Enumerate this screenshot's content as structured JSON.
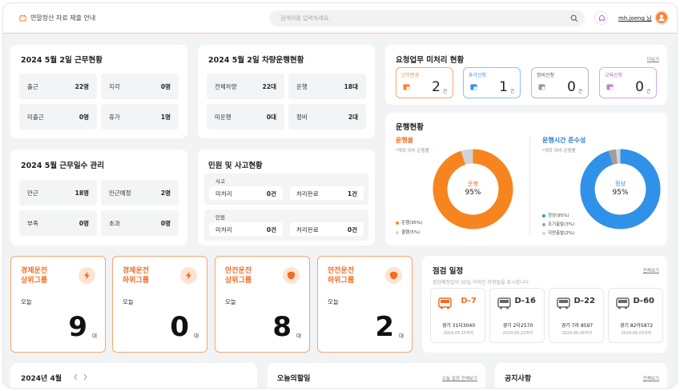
{
  "header": {
    "title": "연말정산 자료 제출 안내",
    "search_placeholder": "검색어를 입력하세요.",
    "user_name": "mh.joeng 님"
  },
  "work_status": {
    "title": "2024 5월 2일 근무현황",
    "cells": [
      {
        "label": "출근",
        "value": "22명"
      },
      {
        "label": "지각",
        "value": "0명"
      },
      {
        "label": "미출근",
        "value": "0명"
      },
      {
        "label": "휴가",
        "value": "1명"
      }
    ]
  },
  "vehicle_status": {
    "title": "2024 5월 2일 차량운행현황",
    "cells": [
      {
        "label": "전체차량",
        "value": "22대"
      },
      {
        "label": "운행",
        "value": "18대"
      },
      {
        "label": "미운행",
        "value": "0대"
      },
      {
        "label": "정비",
        "value": "2대"
      }
    ]
  },
  "work_days": {
    "title": "2024 5월 근무일수 관리",
    "cells": [
      {
        "label": "만근",
        "value": "18명"
      },
      {
        "label": "만근예정",
        "value": "2명"
      },
      {
        "label": "부족",
        "value": "0명"
      },
      {
        "label": "초과",
        "value": "0명"
      }
    ]
  },
  "complaints": {
    "title": "민원 및 사고현황",
    "groups": [
      {
        "label": "사고",
        "cells": [
          {
            "label": "미처리",
            "value": "0건"
          },
          {
            "label": "처리완료",
            "value": "1건"
          }
        ]
      },
      {
        "label": "민원",
        "cells": [
          {
            "label": "미처리",
            "value": "0건"
          },
          {
            "label": "처리완료",
            "value": "0건"
          }
        ]
      }
    ]
  },
  "requests": {
    "title": "요청업무 미처리 현황",
    "more_link": "더보기",
    "items": [
      {
        "label": "근무변경",
        "count": "2",
        "unit": "건",
        "color": "#f7853a",
        "icon": "calendar-swap-icon"
      },
      {
        "label": "휴가신청",
        "count": "1",
        "unit": "건",
        "color": "#3b8fe8",
        "icon": "calendar-plane-icon"
      },
      {
        "label": "정비신청",
        "count": "0",
        "unit": "건",
        "color": "#8a8a8a",
        "icon": "wrench-icon"
      },
      {
        "label": "교육신청",
        "count": "0",
        "unit": "건",
        "color": "#b05fc9",
        "icon": "book-icon"
      }
    ]
  },
  "operation": {
    "title": "운행현황",
    "left": {
      "title": "운행율",
      "subtitle": "*계획 대비 운행률",
      "center_label": "운행",
      "center_value": "95%",
      "percent": 95,
      "color": "#f7851f",
      "legend": [
        {
          "label": "운행(95%)",
          "color": "#f7851f"
        },
        {
          "label": "결행(5%)",
          "color": "#d3d3d3"
        }
      ]
    },
    "right": {
      "title": "운행시간 준수성",
      "subtitle": "*계획 대비 운행률",
      "center_label": "정상",
      "center_value": "95%",
      "percent": 95,
      "color": "#2f92e8",
      "legend": [
        {
          "label": "정상(95%)",
          "color": "#2f92e8"
        },
        {
          "label": "조기출발(3%)",
          "color": "#9e9e9e"
        },
        {
          "label": "지연출발(2%)",
          "color": "#d3d3d3"
        }
      ]
    }
  },
  "driving_groups": [
    {
      "title": "경제운전\n상위그룹",
      "today": "오늘",
      "count": "9",
      "unit": "대"
    },
    {
      "title": "경제운전\n하위그룹",
      "today": "오늘",
      "count": "0",
      "unit": "대"
    },
    {
      "title": "안전운전\n상위그룹",
      "today": "오늘",
      "count": "8",
      "unit": "대"
    },
    {
      "title": "안전운전\n하위그룹",
      "today": "오늘",
      "count": "2",
      "unit": "대"
    }
  ],
  "inspection": {
    "title": "점검 일정",
    "more_link": "전체보기",
    "subtitle": "점검예정일이 30일 이하인 차량들을 표시합니다",
    "items": [
      {
        "code": "D-7",
        "plate": "경기 31다3040",
        "date": "2024.05.15까지",
        "highlight": true
      },
      {
        "code": "D-16",
        "plate": "경기 2다2570",
        "date": "2024.05.22까지",
        "highlight": false
      },
      {
        "code": "D-22",
        "plate": "경기 7라 8597",
        "date": "2024.06.06까지",
        "highlight": false
      },
      {
        "code": "D-60",
        "plate": "경기 82아5872",
        "date": "2024.06.03까지",
        "highlight": false
      }
    ]
  },
  "calendar": {
    "title": "2024년 4월"
  },
  "todo": {
    "title": "오늘의할일",
    "more_link": "오늘 일정 전체보기"
  },
  "notice": {
    "title": "공지사항",
    "more_link": "전체보기"
  }
}
